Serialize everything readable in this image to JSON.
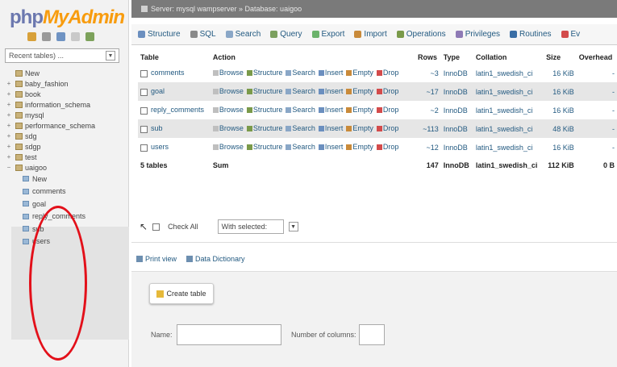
{
  "nav": {
    "logo_part1": "php",
    "logo_part2": "MyAdmin",
    "recent_select": "Recent tables) ...",
    "databases": [
      "New",
      "baby_fashion",
      "book",
      "information_schema",
      "mysql",
      "performance_schema",
      "sdg",
      "sdgp",
      "test",
      "uaigoo"
    ],
    "subtables": [
      "New",
      "comments",
      "goal",
      "reply_comments",
      "sub",
      "users"
    ]
  },
  "breadcrumb": "Server: mysql wampserver » Database: uaigoo",
  "tabs": [
    "Structure",
    "SQL",
    "Search",
    "Query",
    "Export",
    "Import",
    "Operations",
    "Privileges",
    "Routines",
    "Ev"
  ],
  "table": {
    "headers": [
      "Table",
      "Action",
      "Rows",
      "Type",
      "Collation",
      "Size",
      "Overhead"
    ],
    "actions": [
      "Browse",
      "Structure",
      "Search",
      "Insert",
      "Empty",
      "Drop"
    ],
    "rows": [
      {
        "name": "comments",
        "rows": "~3",
        "type": "InnoDB",
        "collation": "latin1_swedish_ci",
        "size": "16 KiB",
        "overhead": "-"
      },
      {
        "name": "goal",
        "rows": "~17",
        "type": "InnoDB",
        "collation": "latin1_swedish_ci",
        "size": "16 KiB",
        "overhead": "-"
      },
      {
        "name": "reply_comments",
        "rows": "~2",
        "type": "InnoDB",
        "collation": "latin1_swedish_ci",
        "size": "16 KiB",
        "overhead": "-"
      },
      {
        "name": "sub",
        "rows": "~113",
        "type": "InnoDB",
        "collation": "latin1_swedish_ci",
        "size": "48 KiB",
        "overhead": "-"
      },
      {
        "name": "users",
        "rows": "~12",
        "type": "InnoDB",
        "collation": "latin1_swedish_ci",
        "size": "16 KiB",
        "overhead": "-"
      }
    ],
    "footer": {
      "name": "5 tables",
      "action": "Sum",
      "rows": "147",
      "type": "InnoDB",
      "collation": "latin1_swedish_ci",
      "size": "112 KiB",
      "overhead": "0 B"
    }
  },
  "check_all": "Check All",
  "with_selected": "With selected:",
  "print_view": "Print view",
  "data_dictionary": "Data Dictionary",
  "create_table": "Create table",
  "name_label": "Name:",
  "columns_label": "Number of columns:",
  "colors": {
    "accent": "#235a81",
    "annotation_circle": "#e3101a",
    "logo_php": "#6c78af",
    "logo_myadmin": "#f89c0e"
  }
}
